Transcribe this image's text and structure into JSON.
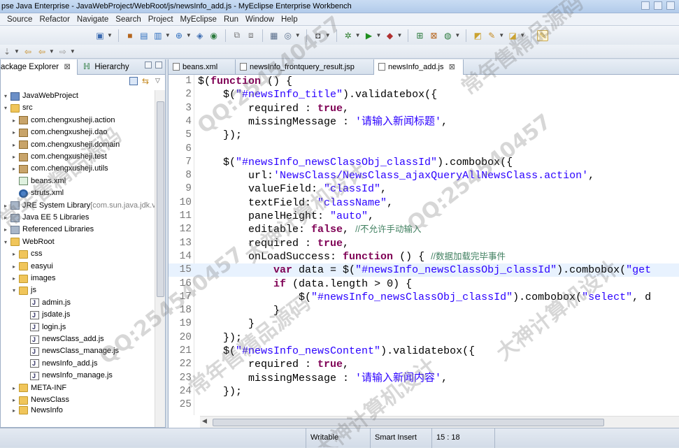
{
  "window": {
    "title": "pse Java Enterprise - JavaWebProject/WebRoot/js/newsInfo_add.js - MyEclipse Enterprise Workbench"
  },
  "menu": [
    "Source",
    "Refactor",
    "Navigate",
    "Search",
    "Project",
    "MyEclipse",
    "Run",
    "Window",
    "Help"
  ],
  "left_panel": {
    "tabs": [
      {
        "label": "ackage Explorer",
        "close": "⊠"
      },
      {
        "label": "Hierarchy"
      }
    ],
    "tree": [
      {
        "label": "JavaWebProject",
        "icon": "project-icon",
        "kind": "proj",
        "twisty": "▾"
      },
      {
        "label": "src",
        "icon": "source-folder-icon",
        "kind": "folder",
        "twisty": "▾"
      },
      {
        "label": "com.chengxusheji.action",
        "icon": "package-icon",
        "kind": "pkg",
        "twisty": "▸"
      },
      {
        "label": "com.chengxusheji.dao",
        "icon": "package-icon",
        "kind": "pkg",
        "twisty": "▸"
      },
      {
        "label": "com.chengxusheji.domain",
        "icon": "package-icon",
        "kind": "pkg",
        "twisty": "▸"
      },
      {
        "label": "com.chengxusheji.test",
        "icon": "package-icon",
        "kind": "pkg",
        "twisty": "▸"
      },
      {
        "label": "com.chengxusheji.utils",
        "icon": "package-icon",
        "kind": "pkg",
        "twisty": "▸"
      },
      {
        "label": "beans.xml",
        "icon": "xml-file-icon",
        "kind": "xmlf",
        "twisty": ""
      },
      {
        "label": "struts.xml",
        "icon": "struts-file-icon",
        "kind": "gear",
        "twisty": ""
      },
      {
        "label": "JRE System Library",
        "suffix": " [com.sun.java.jdk.v",
        "icon": "library-icon",
        "kind": "lib",
        "twisty": "▸"
      },
      {
        "label": "Java EE 5 Libraries",
        "icon": "library-icon",
        "kind": "lib",
        "twisty": "▸"
      },
      {
        "label": "Referenced Libraries",
        "icon": "library-icon",
        "kind": "lib",
        "twisty": "▸"
      },
      {
        "label": "WebRoot",
        "icon": "folder-icon",
        "kind": "folder",
        "twisty": "▾"
      },
      {
        "label": "css",
        "icon": "folder-icon",
        "kind": "folder",
        "twisty": "▸"
      },
      {
        "label": "easyui",
        "icon": "folder-icon",
        "kind": "folder",
        "twisty": "▸"
      },
      {
        "label": "images",
        "icon": "folder-icon",
        "kind": "folder",
        "twisty": "▸"
      },
      {
        "label": "js",
        "icon": "folder-icon",
        "kind": "folder",
        "twisty": "▾"
      },
      {
        "label": "admin.js",
        "icon": "js-file-icon",
        "kind": "jsf",
        "twisty": ""
      },
      {
        "label": "jsdate.js",
        "icon": "js-file-icon",
        "kind": "jsf",
        "twisty": ""
      },
      {
        "label": "login.js",
        "icon": "js-file-icon",
        "kind": "jsf",
        "twisty": ""
      },
      {
        "label": "newsClass_add.js",
        "icon": "js-file-icon",
        "kind": "jsf",
        "twisty": ""
      },
      {
        "label": "newsClass_manage.js",
        "icon": "js-file-icon",
        "kind": "jsf",
        "twisty": ""
      },
      {
        "label": "newsInfo_add.js",
        "icon": "js-file-icon",
        "kind": "jsf",
        "twisty": ""
      },
      {
        "label": "newsInfo_manage.js",
        "icon": "js-file-icon",
        "kind": "jsf",
        "twisty": ""
      },
      {
        "label": "META-INF",
        "icon": "folder-icon",
        "kind": "folder",
        "twisty": "▸"
      },
      {
        "label": "NewsClass",
        "icon": "folder-icon",
        "kind": "folder",
        "twisty": "▸"
      },
      {
        "label": "NewsInfo",
        "icon": "folder-icon",
        "kind": "folder",
        "twisty": "▸"
      }
    ]
  },
  "editor": {
    "tabs": [
      {
        "label": "beans.xml",
        "icon": "xml-file-icon",
        "active": false
      },
      {
        "label": "newsInfo_frontquery_result.jsp",
        "icon": "jsp-file-icon",
        "active": false
      },
      {
        "label": "newsInfo_add.js",
        "icon": "js-file-icon",
        "active": true,
        "close": "⊠"
      }
    ],
    "current_line": 15,
    "lines": [
      {
        "n": "1",
        "t": [
          [
            "k",
            "$("
          ],
          [
            "kw",
            "function"
          ],
          [
            "k",
            " () {"
          ]
        ]
      },
      {
        "n": "2",
        "t": [
          [
            "k",
            "    $("
          ],
          [
            "str",
            "\"#newsInfo_title\""
          ],
          [
            "k",
            ").validatebox({"
          ]
        ]
      },
      {
        "n": "3",
        "t": [
          [
            "k",
            "        required : "
          ],
          [
            "kw",
            "true"
          ],
          [
            "k",
            ","
          ]
        ]
      },
      {
        "n": "4",
        "t": [
          [
            "k",
            "        missingMessage : "
          ],
          [
            "str",
            "'请输入新闻标题'"
          ],
          [
            "k",
            ","
          ]
        ]
      },
      {
        "n": "5",
        "t": [
          [
            "k",
            "    });"
          ]
        ]
      },
      {
        "n": "6",
        "t": [
          [
            "k",
            ""
          ]
        ]
      },
      {
        "n": "7",
        "t": [
          [
            "k",
            "    $("
          ],
          [
            "str",
            "\"#newsInfo_newsClassObj_classId\""
          ],
          [
            "k",
            ").combobox({"
          ]
        ]
      },
      {
        "n": "8",
        "t": [
          [
            "k",
            "        url:"
          ],
          [
            "str",
            "'NewsClass/NewsClass_ajaxQueryAllNewsClass.action'"
          ],
          [
            "k",
            ","
          ]
        ]
      },
      {
        "n": "9",
        "t": [
          [
            "k",
            "        valueField: "
          ],
          [
            "str",
            "\"classId\""
          ],
          [
            "k",
            ","
          ]
        ]
      },
      {
        "n": "10",
        "t": [
          [
            "k",
            "        textField: "
          ],
          [
            "str",
            "\"className\""
          ],
          [
            "k",
            ","
          ]
        ]
      },
      {
        "n": "11",
        "t": [
          [
            "k",
            "        panelHeight: "
          ],
          [
            "str",
            "\"auto\""
          ],
          [
            "k",
            ","
          ]
        ]
      },
      {
        "n": "12",
        "t": [
          [
            "k",
            "        editable: "
          ],
          [
            "kw",
            "false"
          ],
          [
            "k",
            ", "
          ],
          [
            "cmt",
            "//不允许手动输入"
          ]
        ]
      },
      {
        "n": "13",
        "t": [
          [
            "k",
            "        required : "
          ],
          [
            "kw",
            "true"
          ],
          [
            "k",
            ","
          ]
        ]
      },
      {
        "n": "14",
        "t": [
          [
            "k",
            "        onLoadSuccess: "
          ],
          [
            "kw",
            "function"
          ],
          [
            "k",
            " () { "
          ],
          [
            "cmt",
            "//数据加载完毕事件"
          ]
        ]
      },
      {
        "n": "15",
        "t": [
          [
            "k",
            "            "
          ],
          [
            "kw",
            "var"
          ],
          [
            "k",
            " data = $("
          ],
          [
            "str",
            "\"#newsInfo_newsClassObj_classId\""
          ],
          [
            "k",
            ").combobox("
          ],
          [
            "str",
            "\"get"
          ]
        ]
      },
      {
        "n": "16",
        "t": [
          [
            "k",
            "            "
          ],
          [
            "kw",
            "if"
          ],
          [
            "k",
            " (data.length > 0) {"
          ]
        ]
      },
      {
        "n": "17",
        "t": [
          [
            "k",
            "                $("
          ],
          [
            "str",
            "\"#newsInfo_newsClassObj_classId\""
          ],
          [
            "k",
            ").combobox("
          ],
          [
            "str",
            "\"select\""
          ],
          [
            "k",
            ", d"
          ]
        ]
      },
      {
        "n": "18",
        "t": [
          [
            "k",
            "            }"
          ]
        ]
      },
      {
        "n": "19",
        "t": [
          [
            "k",
            "        }"
          ]
        ]
      },
      {
        "n": "20",
        "t": [
          [
            "k",
            "    });"
          ]
        ]
      },
      {
        "n": "21",
        "t": [
          [
            "k",
            "    $("
          ],
          [
            "str",
            "\"#newsInfo_newsContent\""
          ],
          [
            "k",
            ").validatebox({"
          ]
        ]
      },
      {
        "n": "22",
        "t": [
          [
            "k",
            "        required : "
          ],
          [
            "kw",
            "true"
          ],
          [
            "k",
            ","
          ]
        ]
      },
      {
        "n": "23",
        "t": [
          [
            "k",
            "        missingMessage : "
          ],
          [
            "str",
            "'请输入新闻内容'"
          ],
          [
            "k",
            ","
          ]
        ]
      },
      {
        "n": "24",
        "t": [
          [
            "k",
            "    });"
          ]
        ]
      },
      {
        "n": "25",
        "t": [
          [
            "k",
            ""
          ]
        ]
      }
    ]
  },
  "status": {
    "writable": "Writable",
    "insert_mode": "Smart Insert",
    "position": "15 : 18"
  },
  "watermarks": [
    "QQ:254540457",
    "大神计算机设计",
    "常年售精品源码"
  ]
}
